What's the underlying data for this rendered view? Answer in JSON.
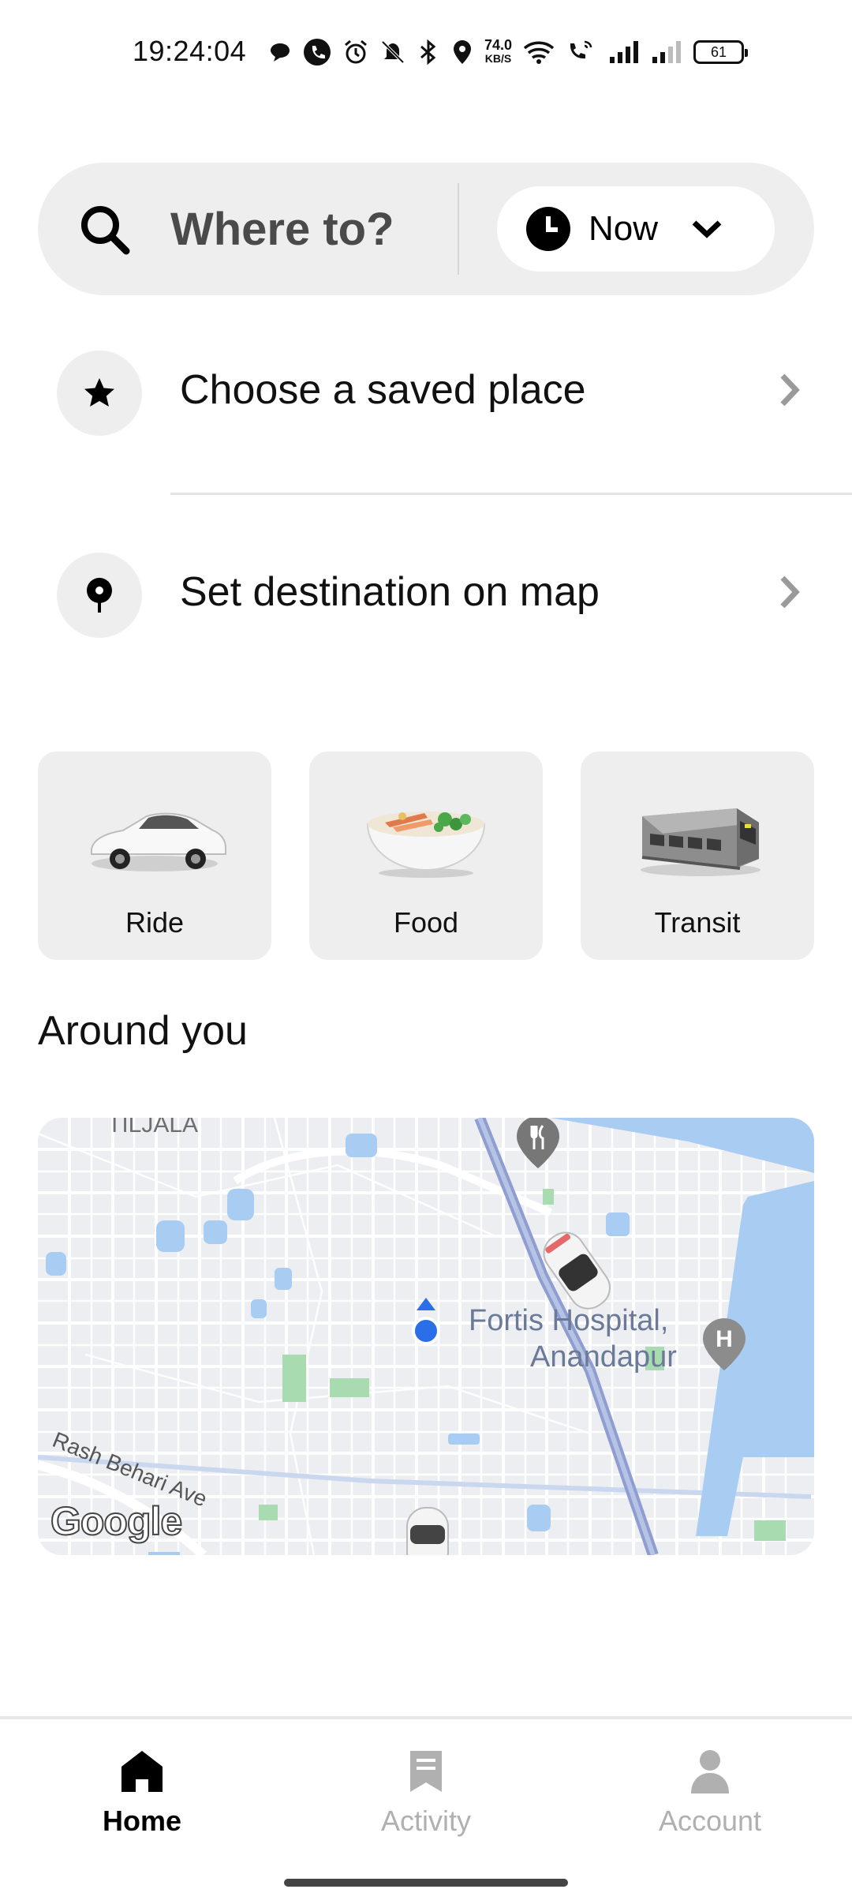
{
  "status_bar": {
    "time": "19:24:04",
    "net_speed_value": "74.0",
    "net_speed_unit": "KB/S",
    "battery": "61"
  },
  "search": {
    "placeholder": "Where to?",
    "time_option": "Now"
  },
  "shortcuts": [
    {
      "label": "Choose a saved place",
      "icon": "star-icon"
    },
    {
      "label": "Set destination on map",
      "icon": "map-pin-icon"
    }
  ],
  "services": [
    {
      "label": "Ride",
      "icon": "car-image"
    },
    {
      "label": "Food",
      "icon": "food-bowl-image"
    },
    {
      "label": "Transit",
      "icon": "train-image"
    }
  ],
  "around_you": {
    "title": "Around you",
    "map": {
      "area_label": "TILJALA",
      "poi_label_line1": "Fortis Hospital,",
      "poi_label_line2": "Anandapur",
      "street_label": "Rash Behari Ave",
      "attribution": "Google"
    }
  },
  "bottom_nav": {
    "items": [
      {
        "label": "Home",
        "active": true
      },
      {
        "label": "Activity",
        "active": false
      },
      {
        "label": "Account",
        "active": false
      }
    ]
  },
  "colors": {
    "surface": "#eeeeee",
    "inactive": "#b0b0b0",
    "map_water": "#a9cdf2",
    "map_park": "#a8dcb0",
    "location_blue": "#2a6ee8"
  }
}
